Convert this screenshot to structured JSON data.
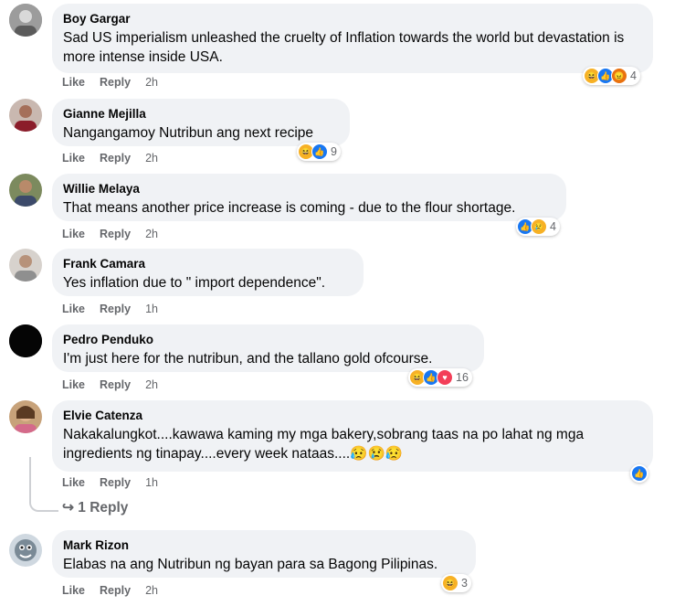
{
  "comments": [
    {
      "name": "Boy Gargar",
      "text": "Sad US imperialism unleashed the cruelty of Inflation towards the world but devastation is more intense inside USA.",
      "like": "Like",
      "reply": "Reply",
      "time": "2h",
      "reactions": [
        "haha",
        "like",
        "angry"
      ],
      "count": "4"
    },
    {
      "name": "Gianne Mejilla",
      "text": "Nangangamoy Nutribun ang next recipe",
      "like": "Like",
      "reply": "Reply",
      "time": "2h",
      "reactions": [
        "haha",
        "like"
      ],
      "count": "9"
    },
    {
      "name": "Willie Melaya",
      "text": "That means another price increase is coming - due to the flour shortage.",
      "like": "Like",
      "reply": "Reply",
      "time": "2h",
      "reactions": [
        "like",
        "sad"
      ],
      "count": "4"
    },
    {
      "name": "Frank Camara",
      "text": "Yes inflation due to \" import dependence\".",
      "like": "Like",
      "reply": "Reply",
      "time": "1h"
    },
    {
      "name": "Pedro Penduko",
      "text": "I'm just here for the nutribun, and the tallano gold ofcourse.",
      "like": "Like",
      "reply": "Reply",
      "time": "2h",
      "reactions": [
        "haha",
        "like",
        "love"
      ],
      "count": "16"
    },
    {
      "name": "Elvie Catenza",
      "text": "Nakakalungkot....kawawa kaming my mga bakery,sobrang taas na po lahat ng mga ingredients ng tinapay....every week nataas....😥😢😥",
      "like": "Like",
      "reply": "Reply",
      "time": "1h",
      "reactions": [
        "like"
      ],
      "count": ""
    },
    {
      "name": "Mark Rizon",
      "text": "Elabas na ang Nutribun ng bayan para sa Bagong Pilipinas.",
      "like": "Like",
      "reply": "Reply",
      "time": "2h",
      "reactions": [
        "haha"
      ],
      "count": "3"
    }
  ],
  "replies_link": "↪ 1 Reply"
}
